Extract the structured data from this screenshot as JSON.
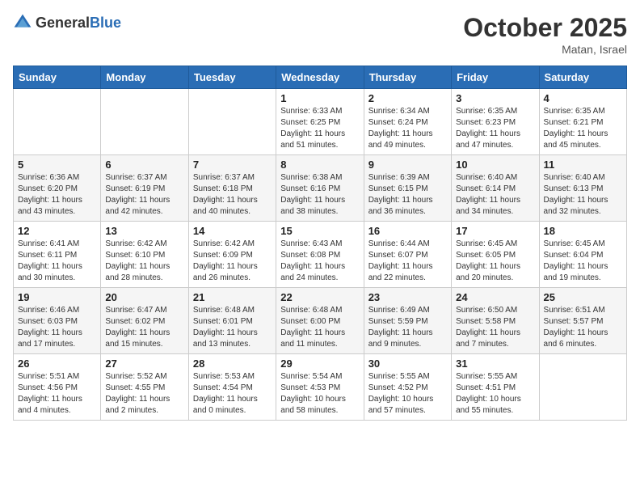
{
  "header": {
    "logo_general": "General",
    "logo_blue": "Blue",
    "month_title": "October 2025",
    "location": "Matan, Israel"
  },
  "weekdays": [
    "Sunday",
    "Monday",
    "Tuesday",
    "Wednesday",
    "Thursday",
    "Friday",
    "Saturday"
  ],
  "weeks": [
    [
      {
        "day": "",
        "info": ""
      },
      {
        "day": "",
        "info": ""
      },
      {
        "day": "",
        "info": ""
      },
      {
        "day": "1",
        "info": "Sunrise: 6:33 AM\nSunset: 6:25 PM\nDaylight: 11 hours\nand 51 minutes."
      },
      {
        "day": "2",
        "info": "Sunrise: 6:34 AM\nSunset: 6:24 PM\nDaylight: 11 hours\nand 49 minutes."
      },
      {
        "day": "3",
        "info": "Sunrise: 6:35 AM\nSunset: 6:23 PM\nDaylight: 11 hours\nand 47 minutes."
      },
      {
        "day": "4",
        "info": "Sunrise: 6:35 AM\nSunset: 6:21 PM\nDaylight: 11 hours\nand 45 minutes."
      }
    ],
    [
      {
        "day": "5",
        "info": "Sunrise: 6:36 AM\nSunset: 6:20 PM\nDaylight: 11 hours\nand 43 minutes."
      },
      {
        "day": "6",
        "info": "Sunrise: 6:37 AM\nSunset: 6:19 PM\nDaylight: 11 hours\nand 42 minutes."
      },
      {
        "day": "7",
        "info": "Sunrise: 6:37 AM\nSunset: 6:18 PM\nDaylight: 11 hours\nand 40 minutes."
      },
      {
        "day": "8",
        "info": "Sunrise: 6:38 AM\nSunset: 6:16 PM\nDaylight: 11 hours\nand 38 minutes."
      },
      {
        "day": "9",
        "info": "Sunrise: 6:39 AM\nSunset: 6:15 PM\nDaylight: 11 hours\nand 36 minutes."
      },
      {
        "day": "10",
        "info": "Sunrise: 6:40 AM\nSunset: 6:14 PM\nDaylight: 11 hours\nand 34 minutes."
      },
      {
        "day": "11",
        "info": "Sunrise: 6:40 AM\nSunset: 6:13 PM\nDaylight: 11 hours\nand 32 minutes."
      }
    ],
    [
      {
        "day": "12",
        "info": "Sunrise: 6:41 AM\nSunset: 6:11 PM\nDaylight: 11 hours\nand 30 minutes."
      },
      {
        "day": "13",
        "info": "Sunrise: 6:42 AM\nSunset: 6:10 PM\nDaylight: 11 hours\nand 28 minutes."
      },
      {
        "day": "14",
        "info": "Sunrise: 6:42 AM\nSunset: 6:09 PM\nDaylight: 11 hours\nand 26 minutes."
      },
      {
        "day": "15",
        "info": "Sunrise: 6:43 AM\nSunset: 6:08 PM\nDaylight: 11 hours\nand 24 minutes."
      },
      {
        "day": "16",
        "info": "Sunrise: 6:44 AM\nSunset: 6:07 PM\nDaylight: 11 hours\nand 22 minutes."
      },
      {
        "day": "17",
        "info": "Sunrise: 6:45 AM\nSunset: 6:05 PM\nDaylight: 11 hours\nand 20 minutes."
      },
      {
        "day": "18",
        "info": "Sunrise: 6:45 AM\nSunset: 6:04 PM\nDaylight: 11 hours\nand 19 minutes."
      }
    ],
    [
      {
        "day": "19",
        "info": "Sunrise: 6:46 AM\nSunset: 6:03 PM\nDaylight: 11 hours\nand 17 minutes."
      },
      {
        "day": "20",
        "info": "Sunrise: 6:47 AM\nSunset: 6:02 PM\nDaylight: 11 hours\nand 15 minutes."
      },
      {
        "day": "21",
        "info": "Sunrise: 6:48 AM\nSunset: 6:01 PM\nDaylight: 11 hours\nand 13 minutes."
      },
      {
        "day": "22",
        "info": "Sunrise: 6:48 AM\nSunset: 6:00 PM\nDaylight: 11 hours\nand 11 minutes."
      },
      {
        "day": "23",
        "info": "Sunrise: 6:49 AM\nSunset: 5:59 PM\nDaylight: 11 hours\nand 9 minutes."
      },
      {
        "day": "24",
        "info": "Sunrise: 6:50 AM\nSunset: 5:58 PM\nDaylight: 11 hours\nand 7 minutes."
      },
      {
        "day": "25",
        "info": "Sunrise: 6:51 AM\nSunset: 5:57 PM\nDaylight: 11 hours\nand 6 minutes."
      }
    ],
    [
      {
        "day": "26",
        "info": "Sunrise: 5:51 AM\nSunset: 4:56 PM\nDaylight: 11 hours\nand 4 minutes."
      },
      {
        "day": "27",
        "info": "Sunrise: 5:52 AM\nSunset: 4:55 PM\nDaylight: 11 hours\nand 2 minutes."
      },
      {
        "day": "28",
        "info": "Sunrise: 5:53 AM\nSunset: 4:54 PM\nDaylight: 11 hours\nand 0 minutes."
      },
      {
        "day": "29",
        "info": "Sunrise: 5:54 AM\nSunset: 4:53 PM\nDaylight: 10 hours\nand 58 minutes."
      },
      {
        "day": "30",
        "info": "Sunrise: 5:55 AM\nSunset: 4:52 PM\nDaylight: 10 hours\nand 57 minutes."
      },
      {
        "day": "31",
        "info": "Sunrise: 5:55 AM\nSunset: 4:51 PM\nDaylight: 10 hours\nand 55 minutes."
      },
      {
        "day": "",
        "info": ""
      }
    ]
  ]
}
